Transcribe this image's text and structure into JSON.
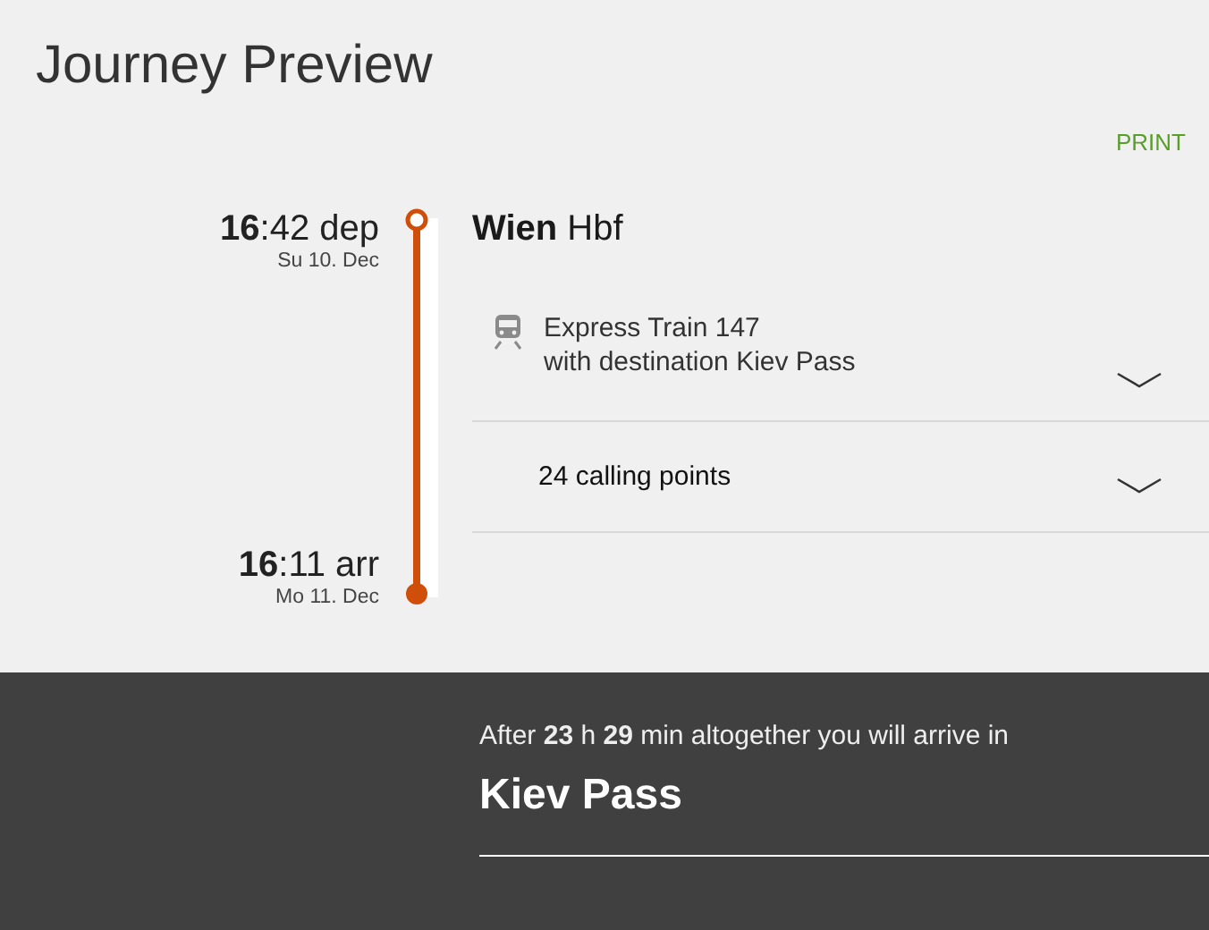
{
  "title": "Journey Preview",
  "print": "PRINT",
  "departure": {
    "time": "**16**:42 dep",
    "date": "Su 10. Dec"
  },
  "arrival": {
    "time": "**16**:11 arr",
    "date": "Mo 11. Dec"
  },
  "station": "**Wien** Hbf",
  "sections": [
    {
      "kind": "train",
      "lines": [
        "Express Train 147",
        "with destination Kiev Pass"
      ],
      "expanded": false
    },
    {
      "kind": "stops",
      "lines": [
        "24 calling points"
      ],
      "expanded": false
    }
  ],
  "summary": {
    "text": "After **23** h **29** min altogether you will arrive in",
    "destination": "Kiev Pass"
  }
}
